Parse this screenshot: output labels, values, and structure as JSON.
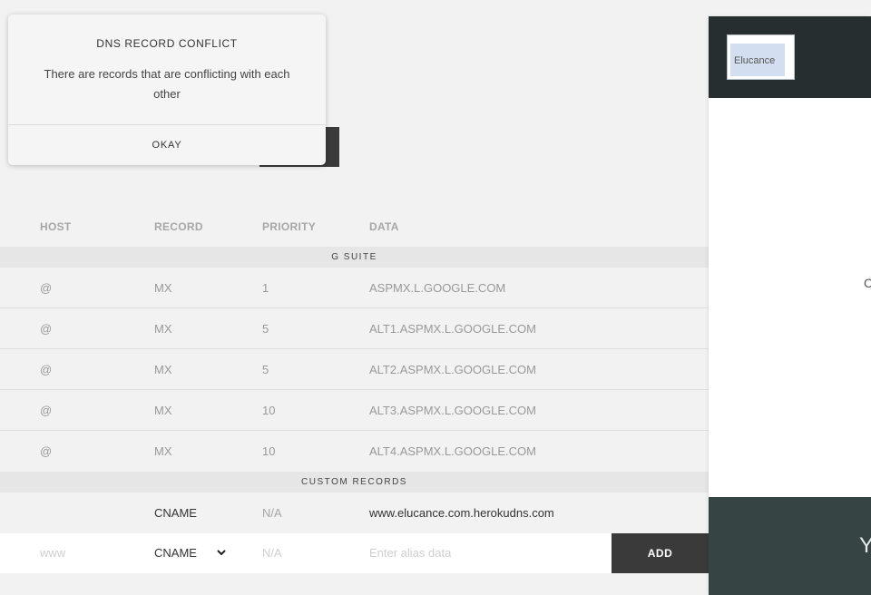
{
  "modal": {
    "title": "DNS RECORD CONFLICT",
    "message": "There are records that are conflicting with each other",
    "ok_label": "OKAY"
  },
  "table": {
    "headers": {
      "host": "HOST",
      "record": "RECORD",
      "priority": "PRIORITY",
      "data": "DATA"
    },
    "gsuite_label": "G SUITE",
    "gsuite_rows": [
      {
        "host": "@",
        "record": "MX",
        "priority": "1",
        "data": "ASPMX.L.GOOGLE.COM"
      },
      {
        "host": "@",
        "record": "MX",
        "priority": "5",
        "data": "ALT1.ASPMX.L.GOOGLE.COM"
      },
      {
        "host": "@",
        "record": "MX",
        "priority": "5",
        "data": "ALT2.ASPMX.L.GOOGLE.COM"
      },
      {
        "host": "@",
        "record": "MX",
        "priority": "10",
        "data": "ALT3.ASPMX.L.GOOGLE.COM"
      },
      {
        "host": "@",
        "record": "MX",
        "priority": "10",
        "data": "ALT4.ASPMX.L.GOOGLE.COM"
      }
    ],
    "custom_label": "CUSTOM RECORDS",
    "custom_rows": [
      {
        "host": "",
        "record": "CNAME",
        "priority": "N/A",
        "data": "www.elucance.com.herokudns.com"
      }
    ],
    "add_row": {
      "host_placeholder": "www",
      "record_selected": "CNAME",
      "priority_placeholder": "N/A",
      "data_placeholder": "Enter alias data",
      "add_label": "ADD"
    }
  },
  "preview": {
    "logo_text": "Elucance",
    "partial_char": "C",
    "footer_partial_char": "Y"
  }
}
